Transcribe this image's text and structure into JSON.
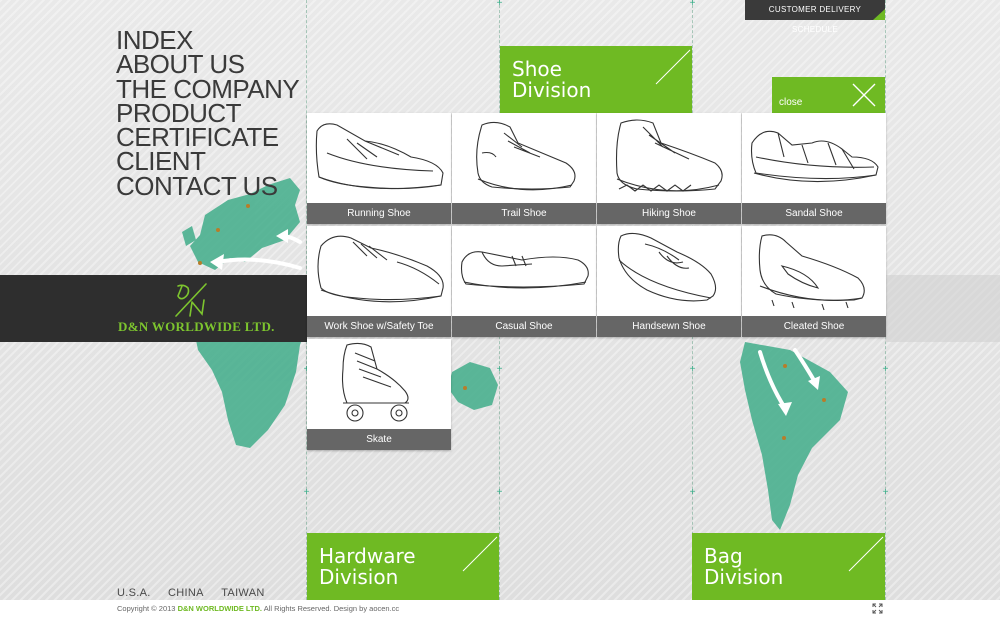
{
  "nav": {
    "items": [
      {
        "label": "INDEX"
      },
      {
        "label": "ABOUT US"
      },
      {
        "label": "THE COMPANY"
      },
      {
        "label": "PRODUCT"
      },
      {
        "label": "CERTIFICATE"
      },
      {
        "label": "CLIENT"
      },
      {
        "label": "CONTACT US"
      }
    ]
  },
  "brand": {
    "name": "D&N WORLDWIDE LTD.",
    "logo_icon": "dn-monogram-icon"
  },
  "top_link": {
    "label": "CUSTOMER DELIVERY SCHEDULE"
  },
  "divisions": {
    "shoe": {
      "label": "Shoe\nDivision"
    },
    "hardware": {
      "label": "Hardware\nDivision"
    },
    "bag": {
      "label": "Bag\nDivision"
    }
  },
  "close": {
    "label": "close",
    "icon": "close-icon"
  },
  "products": [
    {
      "label": "Running Shoe",
      "icon": "running-shoe-icon"
    },
    {
      "label": "Trail Shoe",
      "icon": "trail-shoe-icon"
    },
    {
      "label": "Hiking Shoe",
      "icon": "hiking-shoe-icon"
    },
    {
      "label": "Sandal Shoe",
      "icon": "sandal-shoe-icon"
    },
    {
      "label": "Work Shoe w/Safety Toe",
      "icon": "work-shoe-icon"
    },
    {
      "label": "Casual Shoe",
      "icon": "casual-shoe-icon"
    },
    {
      "label": "Handsewn Shoe",
      "icon": "handsewn-shoe-icon"
    },
    {
      "label": "Cleated Shoe",
      "icon": "cleated-shoe-icon"
    },
    {
      "label": "Skate",
      "icon": "roller-skate-icon"
    }
  ],
  "countries": [
    "U.S.A.",
    "CHINA",
    "TAIWAN"
  ],
  "footer": {
    "prefix": "Copyright © 2013",
    "company": "D&N WORLDWIDE LTD.",
    "suffix": "All Rights Reserved.  Design by aocen.cc",
    "fullscreen_icon": "fullscreen-icon"
  },
  "colors": {
    "accent": "#6fba23",
    "map": "#3fae8a",
    "dark": "#2e2e2e",
    "label_bg": "#666666"
  }
}
